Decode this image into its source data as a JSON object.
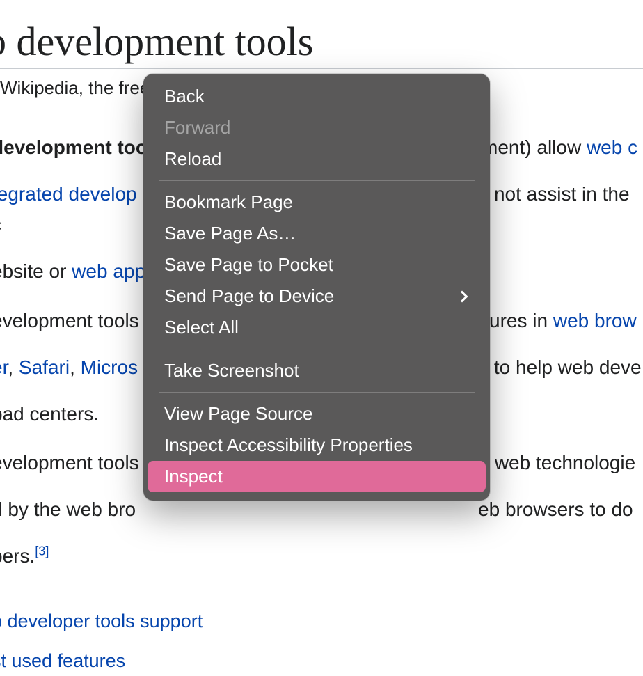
{
  "page": {
    "title": "b development tools",
    "subtitle": "Wikipedia, the free ",
    "p1_part1_bold": "development too",
    "p1_part2": "ment) allow ",
    "p1_link_webc": "web c",
    "p2_link_integrated": "tegrated develop",
    "p2_after": "p not assist in the c",
    "p3_before": "ebsite or ",
    "p3_link_webapp": "web app",
    "p4_before": "evelopment tools",
    "p4_mid": "atures in ",
    "p4_link_browser": "web brow",
    "p5_link_er": "er",
    "p5_sep1": ", ",
    "p5_link_safari": "Safari",
    "p5_sep2": ", ",
    "p5_link_micros": "Micros",
    "p5_after": "s to help web deve",
    "p6": "pad centers.",
    "p7_before": "evelopment tools",
    "p7_after": "of web technologie",
    "p8_before": "d by the web bro",
    "p8_after": "eb browsers to do",
    "p9_before": "pers.",
    "p9_ref": "[3]",
    "toc1": "b developer tools support",
    "toc2": "st used features"
  },
  "menu": {
    "back": "Back",
    "forward": "Forward",
    "reload": "Reload",
    "bookmark": "Bookmark Page",
    "saveAs": "Save Page As…",
    "savePocket": "Save Page to Pocket",
    "sendDevice": "Send Page to Device",
    "selectAll": "Select All",
    "screenshot": "Take Screenshot",
    "viewSource": "View Page Source",
    "inspectA11y": "Inspect Accessibility Properties",
    "inspect": "Inspect"
  }
}
